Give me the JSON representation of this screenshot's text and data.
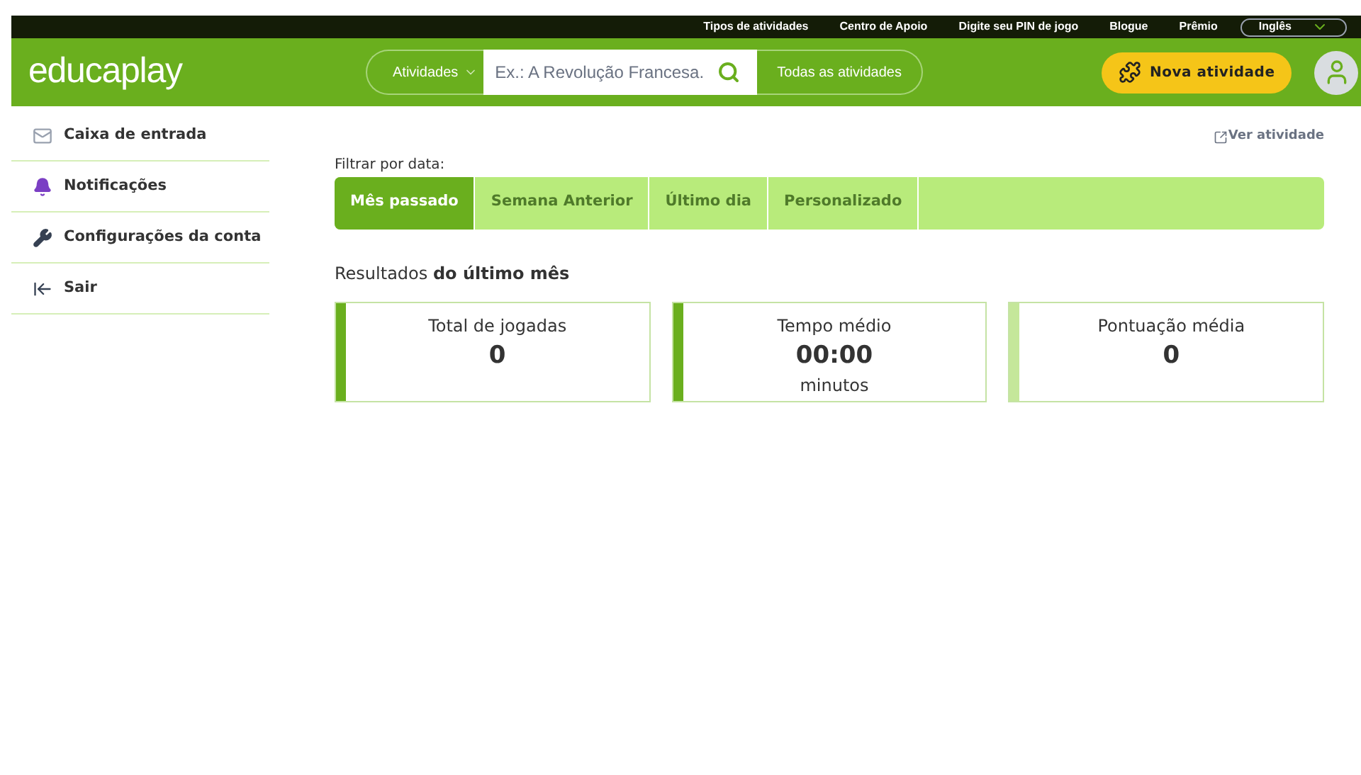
{
  "top_links": [
    "Tipos de atividades",
    "Centro de Apoio",
    "Digite seu PIN de jogo",
    "Blogue",
    "Prêmio"
  ],
  "language": "Inglês",
  "logo": {
    "part1": "educa",
    "part2": "play"
  },
  "search": {
    "category": "Atividades",
    "placeholder": "Ex.: A Revolução Francesa.",
    "all_button": "Todas as atividades"
  },
  "new_activity": "Nova atividade",
  "sidebar": {
    "items": [
      {
        "label": "Caixa de entrada",
        "kind": "mail"
      },
      {
        "label": "Notificações",
        "kind": "bell"
      },
      {
        "label": "Configurações da conta",
        "kind": "wrench"
      },
      {
        "label": "Sair",
        "kind": "exit"
      }
    ]
  },
  "view_activity": "Ver atividade",
  "filter": {
    "label": "Filtrar por data:",
    "tabs": [
      {
        "label": "Mês passado",
        "selected": true
      },
      {
        "label": "Semana Anterior",
        "selected": false
      },
      {
        "label": "Último dia",
        "selected": false
      },
      {
        "label": "Personalizado",
        "selected": false
      }
    ]
  },
  "results_heading": "Resultados **do último mês**",
  "cards": [
    {
      "title": "Total de jogadas",
      "value": "0",
      "color": "#6aaf1e"
    },
    {
      "title": "Tempo médio",
      "value": "00:00",
      "unit": "minutos",
      "color": "#6aaf1e"
    },
    {
      "title": "Pontuação média",
      "value": "0",
      "color": "#c5e79a"
    }
  ]
}
